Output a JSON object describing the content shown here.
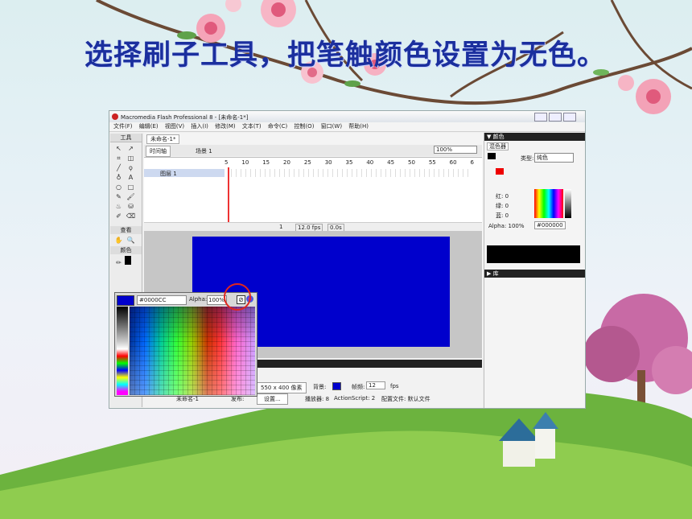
{
  "slide": {
    "title": "选择刷子工具，把笔触颜色设置为无色。"
  },
  "window": {
    "title": "Macromedia Flash Professional 8 - [未命名-1*]",
    "menu": [
      "文件(F)",
      "编辑(E)",
      "视图(V)",
      "插入(I)",
      "修改(M)",
      "文本(T)",
      "命令(C)",
      "控制(O)",
      "窗口(W)",
      "帮助(H)"
    ],
    "tools_label": "工具",
    "view_label": "查看",
    "color_label": "颜色",
    "doc_tab": "未命名-1*",
    "timeline_btn": "时间轴",
    "scene": "场景 1",
    "zoom": "100%",
    "layer_name": "图层 1",
    "frame_numbers": [
      "5",
      "10",
      "15",
      "20",
      "25",
      "30",
      "35",
      "40",
      "45",
      "50",
      "55",
      "60",
      "6"
    ],
    "frame_value": "1",
    "fps": "12.0 fps",
    "time": "0.0s"
  },
  "swatch_popup": {
    "hex": "#0000CC",
    "alpha_label": "Alpha:",
    "alpha_value": "100%"
  },
  "properties": {
    "size_button": "550 x 400 像素",
    "bg_label": "背景:",
    "fps_label": "帧频:",
    "fps_value": "12",
    "fps_unit": "fps",
    "doc_name": "未命名-1",
    "publish_label": "发布:",
    "settings_button": "设置...",
    "player": "播放器: 8",
    "actionscript": "ActionScript:  2",
    "profile": "配置文件: 默认文件"
  },
  "right_panel": {
    "color_header": "▼ 颜色",
    "mixer_tab": "混色器",
    "type_label": "类型:",
    "type_value": "纯色",
    "red": "红: 0",
    "green": "绿: 0",
    "blue": "蓝: 0",
    "alpha": "Alpha: 100%",
    "hex": "#000000",
    "library_header": "▶ 库"
  },
  "colors": {
    "title": "#1b2f9e",
    "stage": "#0000cc",
    "annotation": "#e0261e"
  }
}
